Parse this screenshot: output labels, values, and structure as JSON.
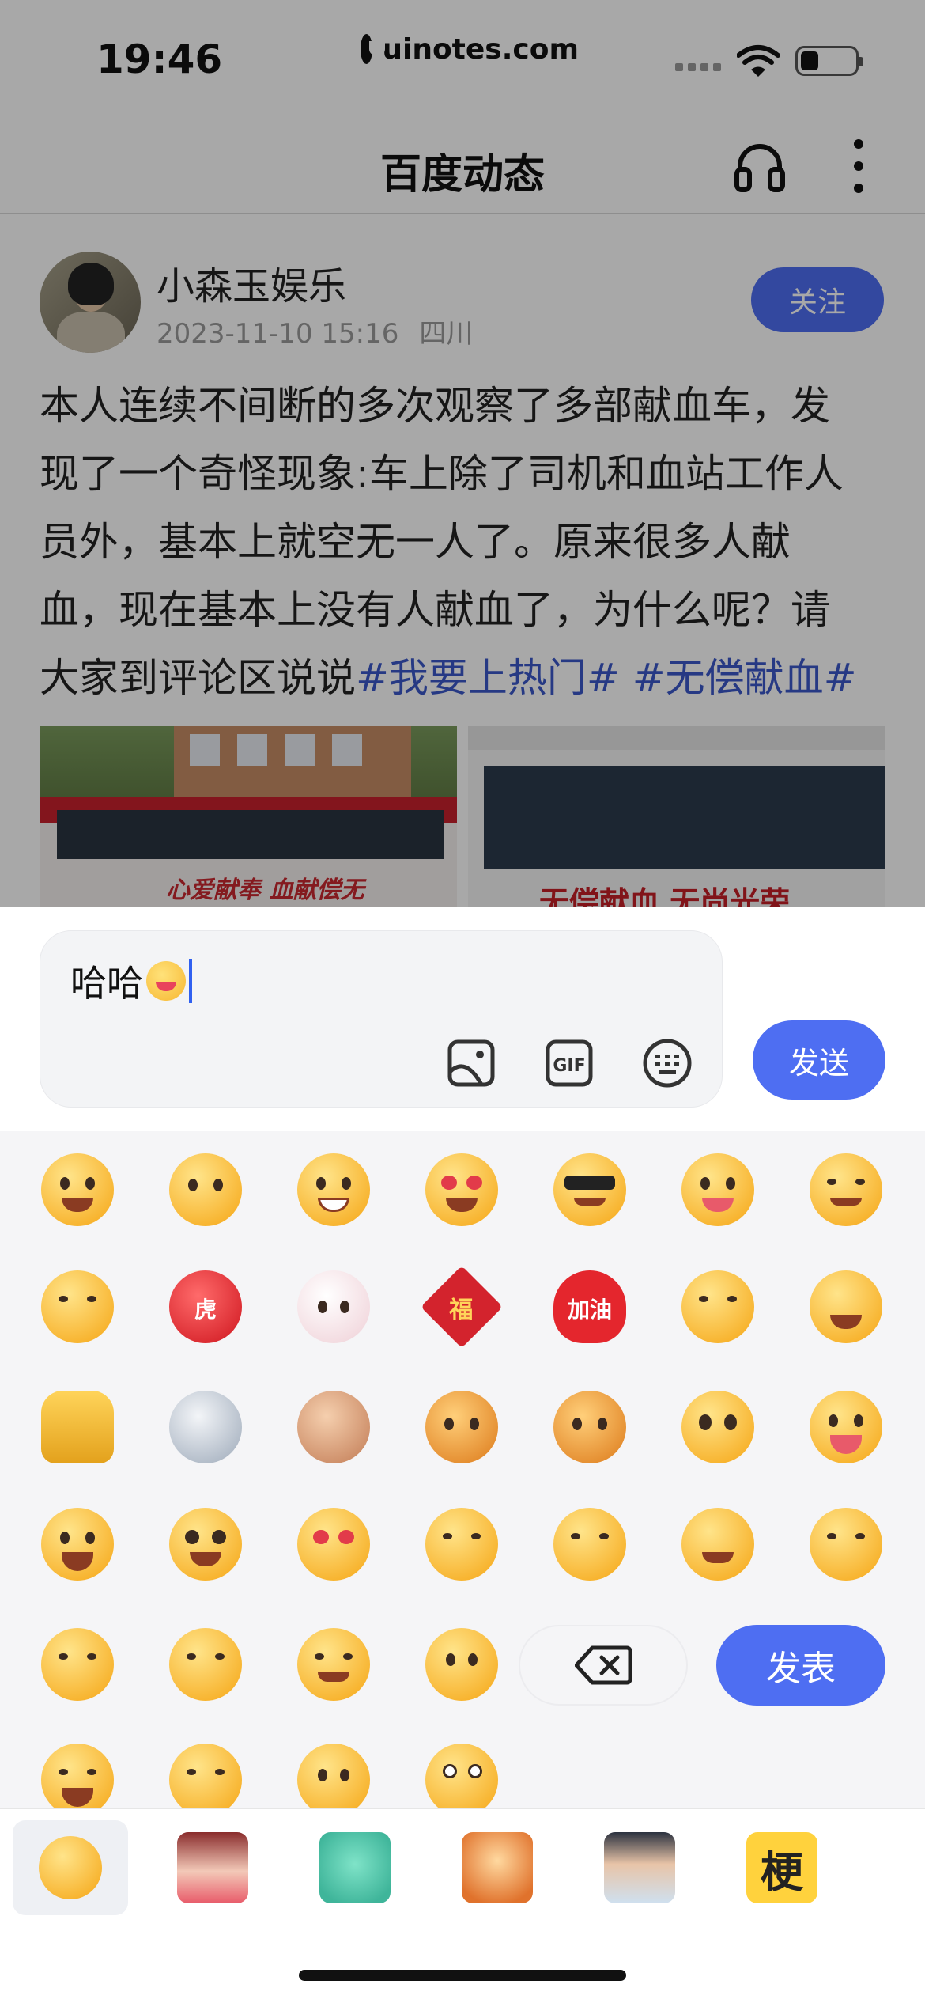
{
  "status_bar": {
    "time": "19:46",
    "url": "uinotes.com"
  },
  "navbar": {
    "title": "百度动态",
    "headphone_icon": "headphone-icon",
    "more_icon": "more-vertical-icon"
  },
  "post": {
    "author": "小森玉娱乐",
    "date": "2023-11-10 15:16",
    "location": "四川",
    "follow_label": "关注",
    "body_line1": "本人连续不间断的多次观察了多部献血车，发",
    "body_line2": "现了一个奇怪现象:车上除了司机和血站工作人",
    "body_line3": "员外，基本上就空无一人了。原来很多人献",
    "body_line4": "血，现在基本上没有人献血了，为什么呢？请",
    "body_line5": "大家到评论区说说",
    "hashtags": [
      "#我要上热门#",
      "#无偿献血#"
    ],
    "image1_text": "心爱献奉 血献偿无",
    "image2_text": "无偿献血  无尚光荣"
  },
  "composer": {
    "input_value": "哈哈",
    "send_label": "发送",
    "tools": [
      "sticker-icon",
      "gif-icon",
      "keyboard-icon"
    ]
  },
  "emoji_panel": {
    "publish_label": "发表",
    "delete_icon": "backspace-icon",
    "emoji_labels": {
      "lantern": "虎",
      "fu": "福",
      "jiayou": "加油"
    }
  },
  "tabs": [
    "emoji-tab",
    "doll-tab",
    "monster-tab",
    "tiger-kid-tab",
    "man-tab",
    "geng-tab"
  ],
  "tab_geng_label": "梗",
  "colors": {
    "accent": "#4e6ef2",
    "hashtag": "#3a57c8",
    "panel_bg": "#f5f5f7"
  }
}
